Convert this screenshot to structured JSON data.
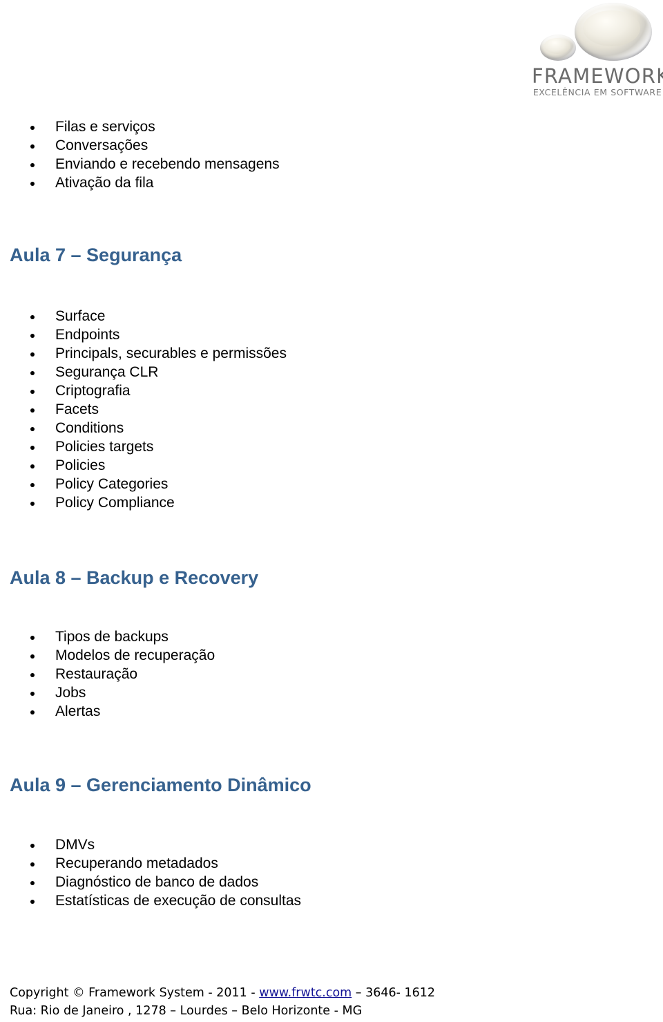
{
  "logo": {
    "wordmark": "FRAMEWORK",
    "tagline": "EXCELÊNCIA EM SOFTWARE",
    "disc_large_icon": "metallic-disc-large-icon",
    "disc_small_icon": "metallic-disc-small-icon"
  },
  "colors": {
    "heading_blue": "#36618E",
    "body_text": "#000000",
    "link_blue": "#141496",
    "logo_gray": "#6B6B6B"
  },
  "sections": [
    {
      "id": "aula6-continued",
      "heading": null,
      "items": [
        "Filas e serviços",
        "Conversações",
        "Enviando e recebendo mensagens",
        "Ativação da fila"
      ]
    },
    {
      "id": "aula7",
      "heading": "Aula 7 – Segurança",
      "items": [
        "Surface",
        "Endpoints",
        "Principals, securables e permissões",
        "Segurança CLR",
        "Criptografia",
        "Facets",
        "Conditions",
        "Policies targets",
        "Policies",
        "Policy Categories",
        "Policy Compliance"
      ]
    },
    {
      "id": "aula8",
      "heading": "Aula 8 – Backup e Recovery",
      "items": [
        "Tipos de backups",
        "Modelos de recuperação",
        "Restauração",
        "Jobs",
        "Alertas"
      ]
    },
    {
      "id": "aula9",
      "heading": "Aula 9 – Gerenciamento Dinâmico",
      "items": [
        "DMVs",
        "Recuperando metadados",
        "Diagnóstico de banco de dados",
        "Estatísticas de execução de consultas"
      ]
    }
  ],
  "footer": {
    "copyright_prefix": "Copyright © Framework System - 2011 - ",
    "site_link": "www.frwtc.com",
    "phone_suffix": "  – 3646- 1612",
    "address": "Rua: Rio de Janeiro , 1278 – Lourdes – Belo Horizonte - MG"
  }
}
